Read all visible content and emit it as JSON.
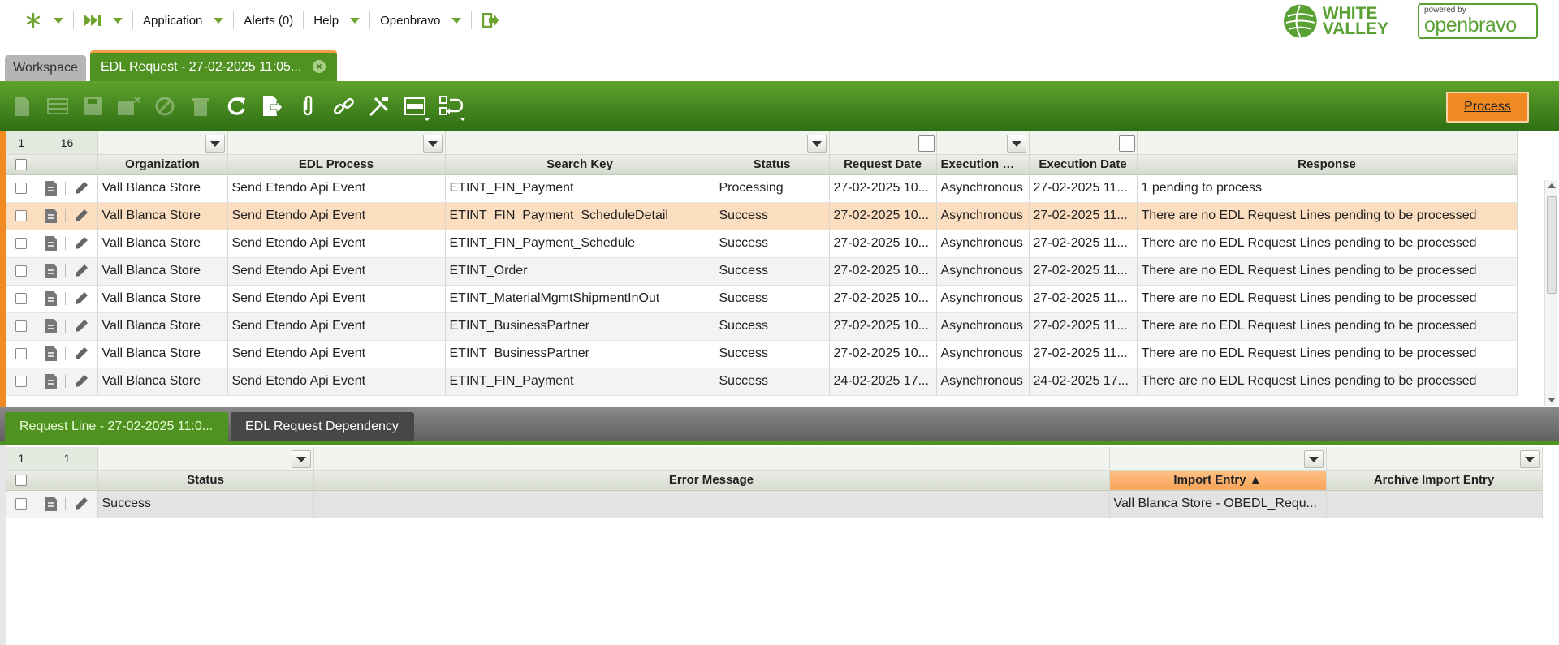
{
  "topnav": {
    "items": [
      "Application",
      "Alerts (0)",
      "Help",
      "Openbravo"
    ]
  },
  "logos": {
    "white_valley": "WHITE\nVALLEY",
    "wv_line1": "WHITE",
    "wv_line2": "VALLEY",
    "powered_by": "powered by",
    "openbravo": "openbravo"
  },
  "tabs": {
    "workspace": "Workspace",
    "edl_request": "EDL Request - 27-02-2025 11:05..."
  },
  "toolbar": {
    "process_label": "Process",
    "buttons": [
      "new-document-icon",
      "new-row-icon",
      "save-icon",
      "undo-icon",
      "cancel-icon",
      "delete-icon",
      "refresh-icon",
      "export-icon",
      "attachment-icon",
      "link-icon",
      "tools-icon",
      "grid-toggle-icon",
      "clone-icon"
    ]
  },
  "main_grid": {
    "selected": "1",
    "total": "16",
    "columns": [
      "Organization",
      "EDL Process",
      "Search Key",
      "Status",
      "Request Date",
      "Execution Mode",
      "Execution Date",
      "Response"
    ],
    "rows": [
      [
        "Vall Blanca Store",
        "Send Etendo Api Event",
        "ETINT_FIN_Payment",
        "Processing",
        "27-02-2025 10...",
        "Asynchronous",
        "27-02-2025 11...",
        "1 pending to process"
      ],
      [
        "Vall Blanca Store",
        "Send Etendo Api Event",
        "ETINT_FIN_Payment_ScheduleDetail",
        "Success",
        "27-02-2025 10...",
        "Asynchronous",
        "27-02-2025 11...",
        "There are no EDL Request Lines pending to be processed"
      ],
      [
        "Vall Blanca Store",
        "Send Etendo Api Event",
        "ETINT_FIN_Payment_Schedule",
        "Success",
        "27-02-2025 10...",
        "Asynchronous",
        "27-02-2025 11...",
        "There are no EDL Request Lines pending to be processed"
      ],
      [
        "Vall Blanca Store",
        "Send Etendo Api Event",
        "ETINT_Order",
        "Success",
        "27-02-2025 10...",
        "Asynchronous",
        "27-02-2025 11...",
        "There are no EDL Request Lines pending to be processed"
      ],
      [
        "Vall Blanca Store",
        "Send Etendo Api Event",
        "ETINT_MaterialMgmtShipmentInOut",
        "Success",
        "27-02-2025 10...",
        "Asynchronous",
        "27-02-2025 11...",
        "There are no EDL Request Lines pending to be processed"
      ],
      [
        "Vall Blanca Store",
        "Send Etendo Api Event",
        "ETINT_BusinessPartner",
        "Success",
        "27-02-2025 10...",
        "Asynchronous",
        "27-02-2025 11...",
        "There are no EDL Request Lines pending to be processed"
      ],
      [
        "Vall Blanca Store",
        "Send Etendo Api Event",
        "ETINT_BusinessPartner",
        "Success",
        "27-02-2025 10...",
        "Asynchronous",
        "27-02-2025 11...",
        "There are no EDL Request Lines pending to be processed"
      ],
      [
        "Vall Blanca Store",
        "Send Etendo Api Event",
        "ETINT_FIN_Payment",
        "Success",
        "24-02-2025 17...",
        "Asynchronous",
        "24-02-2025 17...",
        "There are no EDL Request Lines pending to be processed"
      ]
    ]
  },
  "subtabs": {
    "request_line": "Request Line - 27-02-2025 11:0...",
    "dependency": "EDL Request Dependency"
  },
  "line_grid": {
    "selected": "1",
    "total": "1",
    "columns": [
      "Status",
      "Error Message",
      "Import Entry ▲",
      "Archive Import Entry"
    ],
    "rows": [
      [
        "Success",
        "",
        "Vall Blanca Store - OBEDL_Requ...",
        ""
      ]
    ]
  },
  "colors": {
    "brand_green": "#4f9222",
    "accent_orange": "#f28a24",
    "selected_row": "#fbddc0"
  }
}
